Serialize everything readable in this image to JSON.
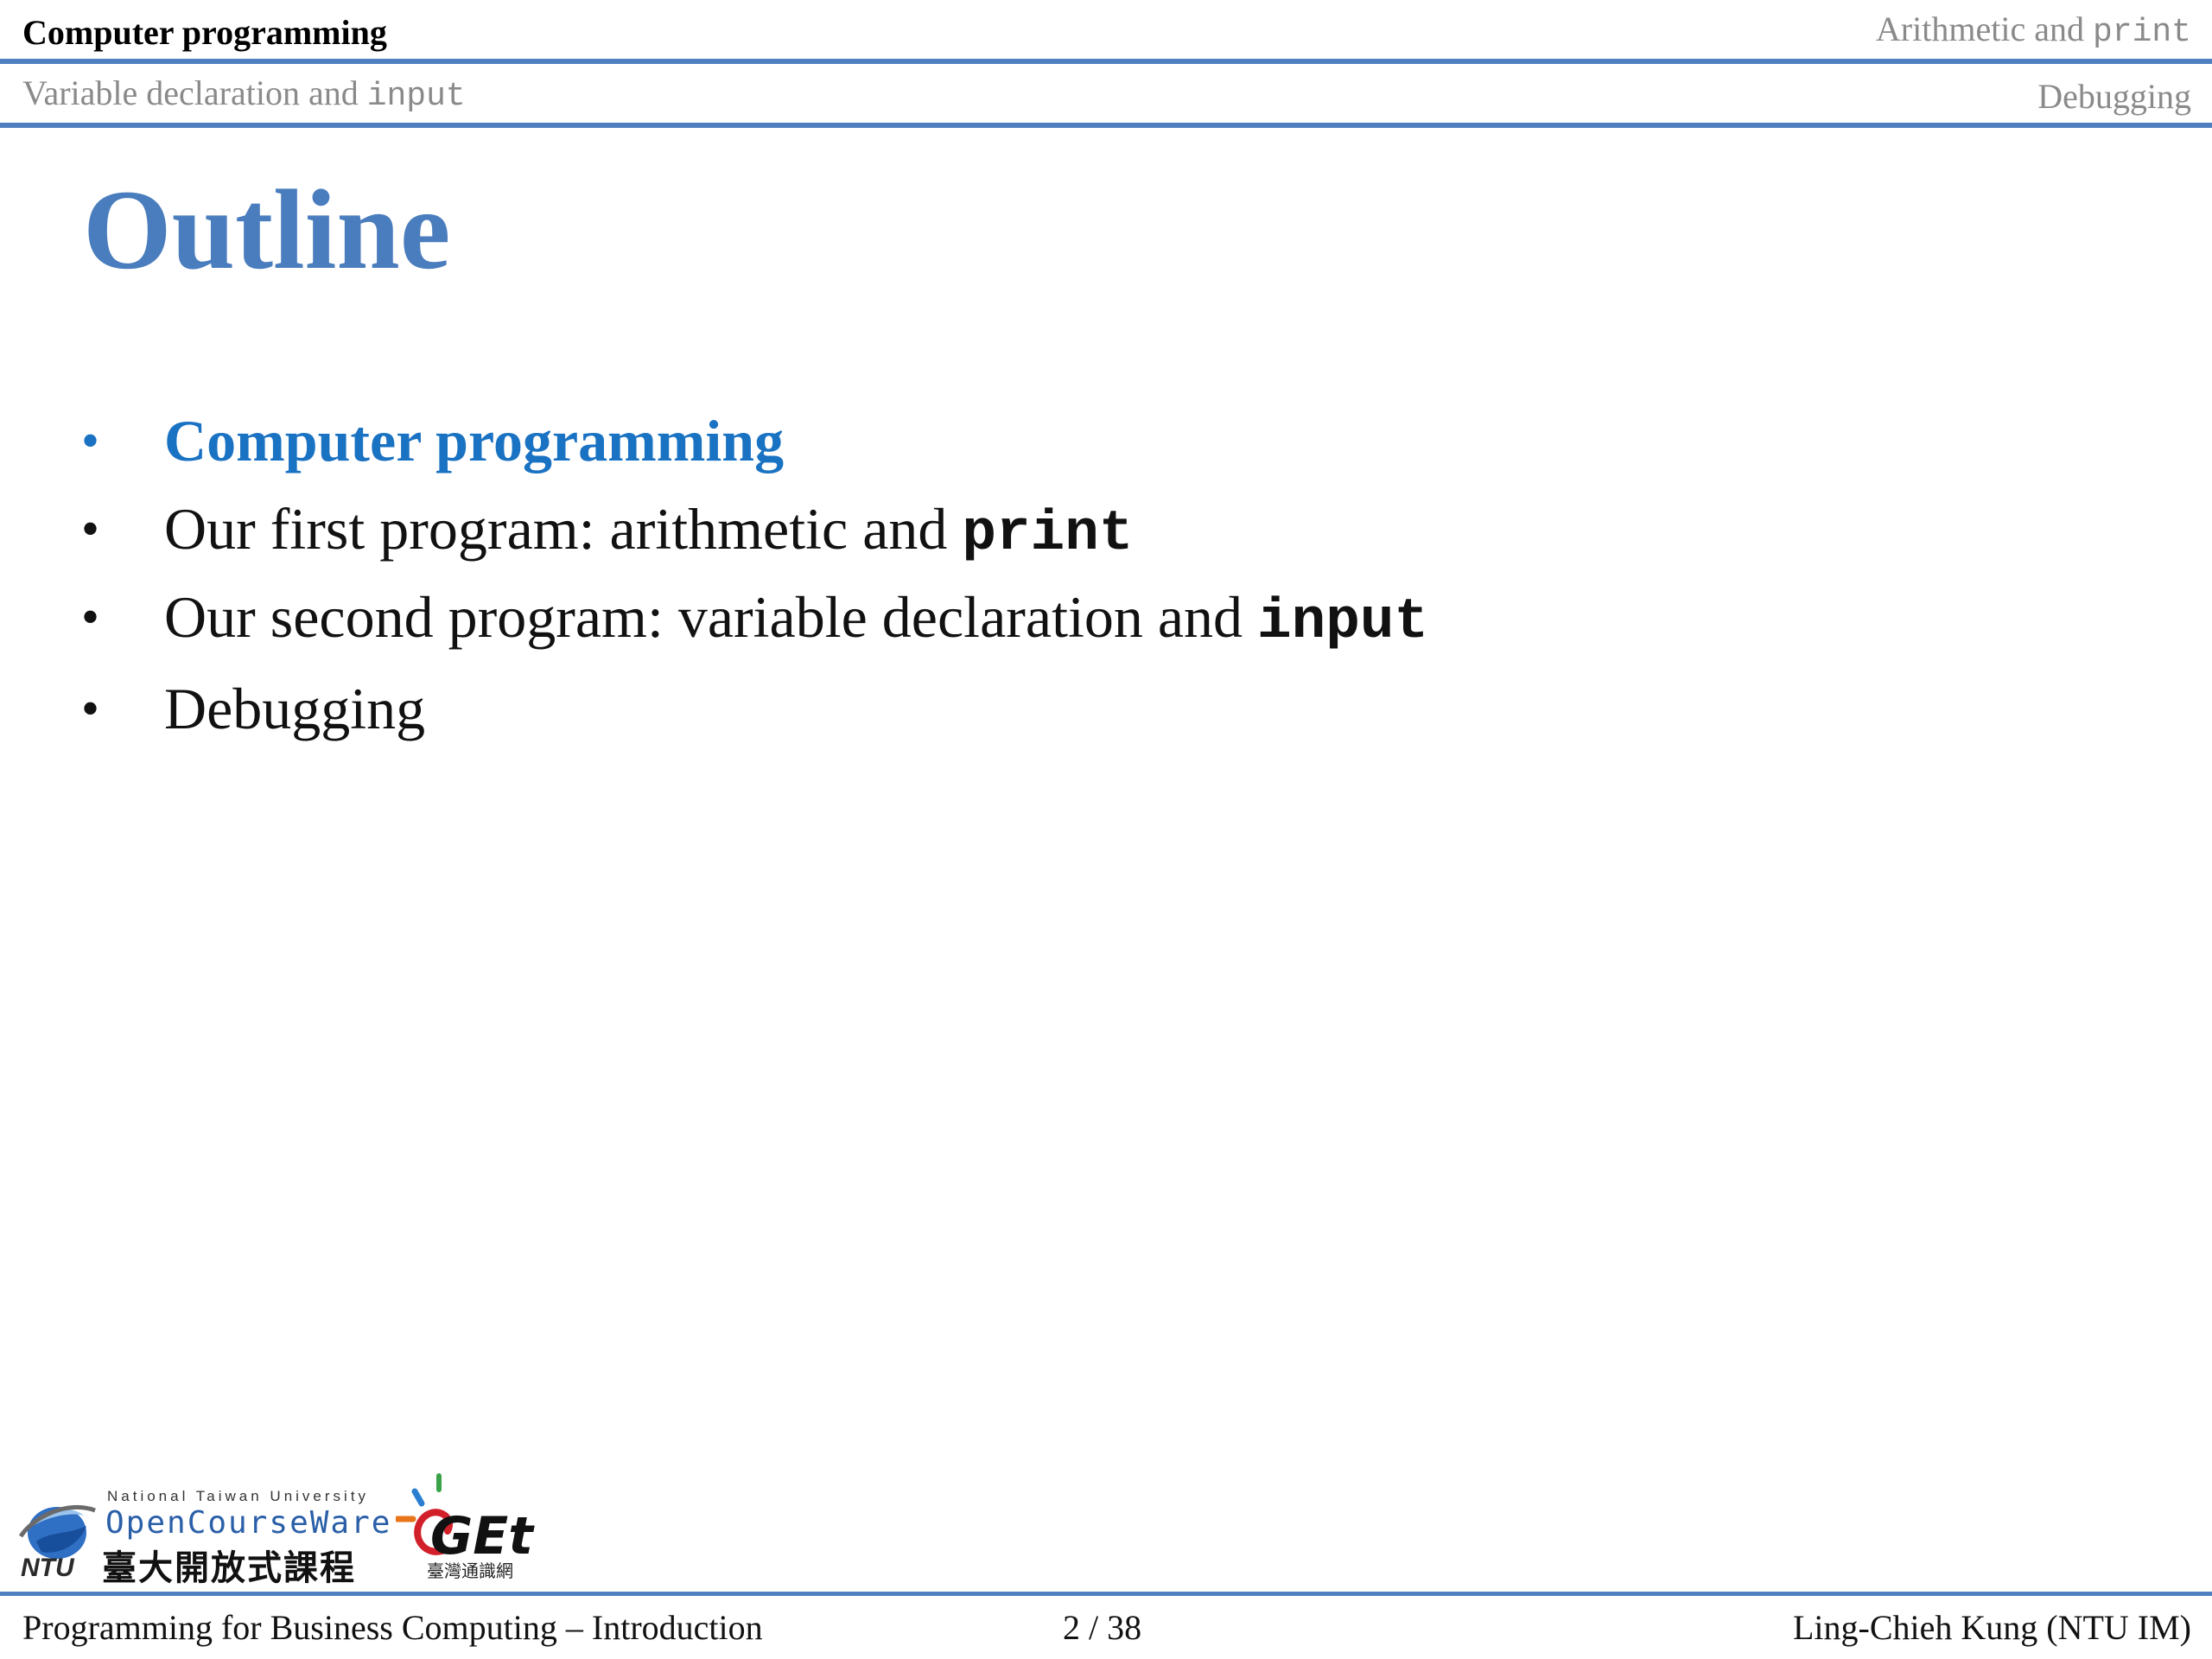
{
  "nav": {
    "sections_row1": {
      "left": "Computer programming",
      "right_prefix": "Arithmetic and ",
      "right_code": "print"
    },
    "sections_row2": {
      "left_prefix": "Variable declaration and ",
      "left_code": "input",
      "right": "Debugging"
    },
    "current_section": "Computer programming"
  },
  "slide": {
    "title": "Outline",
    "items": [
      {
        "text": "Computer programming",
        "code": "",
        "current": true
      },
      {
        "text": "Our first program: arithmetic and ",
        "code": "print",
        "current": false
      },
      {
        "text": "Our second program: variable declaration and ",
        "code": "input",
        "current": false
      },
      {
        "text": "Debugging",
        "code": "",
        "current": false
      }
    ],
    "bullet": "•"
  },
  "logos": {
    "ntu_university": "National Taiwan University",
    "ntu_opencourseware": "OpenCourseWare",
    "ntu_chinese": "臺大開放式課程",
    "ntu_abbrev": "NTU",
    "get_wordmark": "GEt",
    "get_chinese": "臺灣通識網"
  },
  "footer": {
    "course": "Programming for Business Computing – Introduction",
    "page": "2 / 38",
    "author": "Ling-Chieh Kung (NTU IM)"
  },
  "colors": {
    "rule": "#4f7fc0",
    "title": "#4a7dbd",
    "current_item": "#1a72c2",
    "inactive_nav": "#8a8a8a"
  }
}
